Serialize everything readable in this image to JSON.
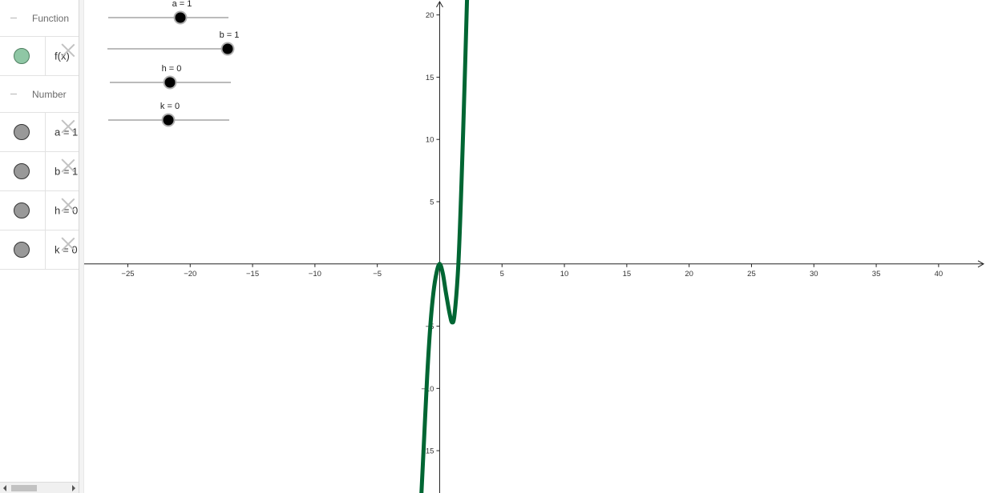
{
  "algebra": {
    "categories": [
      {
        "name": "Function",
        "items": [
          {
            "label": "f(x)"
          }
        ]
      },
      {
        "name": "Number",
        "items": [
          {
            "label": "a = 1"
          },
          {
            "label": "b = 1"
          },
          {
            "label": "h = 0"
          },
          {
            "label": "k = 0"
          }
        ]
      }
    ]
  },
  "sliders": [
    {
      "name": "a",
      "label": "a = 1",
      "value": 1
    },
    {
      "name": "b",
      "label": "b = 1",
      "value": 1
    },
    {
      "name": "h",
      "label": "h = 0",
      "value": 0
    },
    {
      "name": "k",
      "label": "k = 0",
      "value": 0
    }
  ],
  "graph": {
    "x_ticks": [
      -25,
      -20,
      -15,
      -10,
      -5,
      0,
      5,
      10,
      15,
      20,
      25,
      30,
      35,
      40
    ],
    "y_ticks": [
      -15,
      -10,
      -5,
      5,
      10,
      15,
      20
    ],
    "x_range": [
      -28.5,
      43.8
    ],
    "y_range": [
      -18.4,
      21.2
    ],
    "curve": {
      "color": "#006633",
      "points": [
        [
          -1.5,
          -19.2
        ],
        [
          -1.25,
          -14.1
        ],
        [
          -1.0,
          -9.0
        ],
        [
          -0.75,
          -5.0
        ],
        [
          -0.5,
          -2.3
        ],
        [
          -0.25,
          -0.7
        ],
        [
          0,
          0
        ],
        [
          0.25,
          -0.75
        ],
        [
          0.5,
          -2.3
        ],
        [
          0.8,
          -4.0
        ],
        [
          1.0,
          -4.7
        ],
        [
          1.2,
          -4.0
        ],
        [
          1.5,
          0
        ],
        [
          1.75,
          6.5
        ],
        [
          2.0,
          14.5
        ],
        [
          2.2,
          21.5
        ]
      ]
    }
  }
}
